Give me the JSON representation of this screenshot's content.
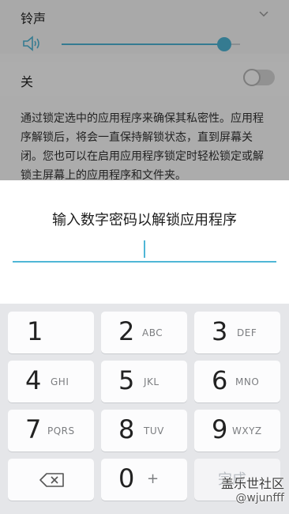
{
  "settings": {
    "volume_title": "铃声",
    "toggle_label": "关",
    "description": "通过锁定选中的应用程序来确保其私密性。应用程序解锁后，将会一直保持解锁状态，直到屏幕关闭。您也可以在启用应用程序锁定时轻松锁定或解锁主屏幕上的应用程序和文件夹。",
    "volume_level": 0.91,
    "toggle_on": false
  },
  "dialog": {
    "title": "输入数字密码以解锁应用程序",
    "pin_value": "",
    "accent": "#4fb6d6"
  },
  "keypad": {
    "keys": [
      {
        "num": "1",
        "sub": ""
      },
      {
        "num": "2",
        "sub": "ABC"
      },
      {
        "num": "3",
        "sub": "DEF"
      },
      {
        "num": "4",
        "sub": "GHI"
      },
      {
        "num": "5",
        "sub": "JKL"
      },
      {
        "num": "6",
        "sub": "MNO"
      },
      {
        "num": "7",
        "sub": "PQRS"
      },
      {
        "num": "8",
        "sub": "TUV"
      },
      {
        "num": "9",
        "sub": "WXYZ"
      }
    ],
    "zero": {
      "num": "0",
      "sub": "+"
    },
    "done_label": "完成",
    "backspace_icon": "backspace-icon"
  },
  "watermark": {
    "line1": "盖乐世社区",
    "line2": "@wjunfff"
  }
}
